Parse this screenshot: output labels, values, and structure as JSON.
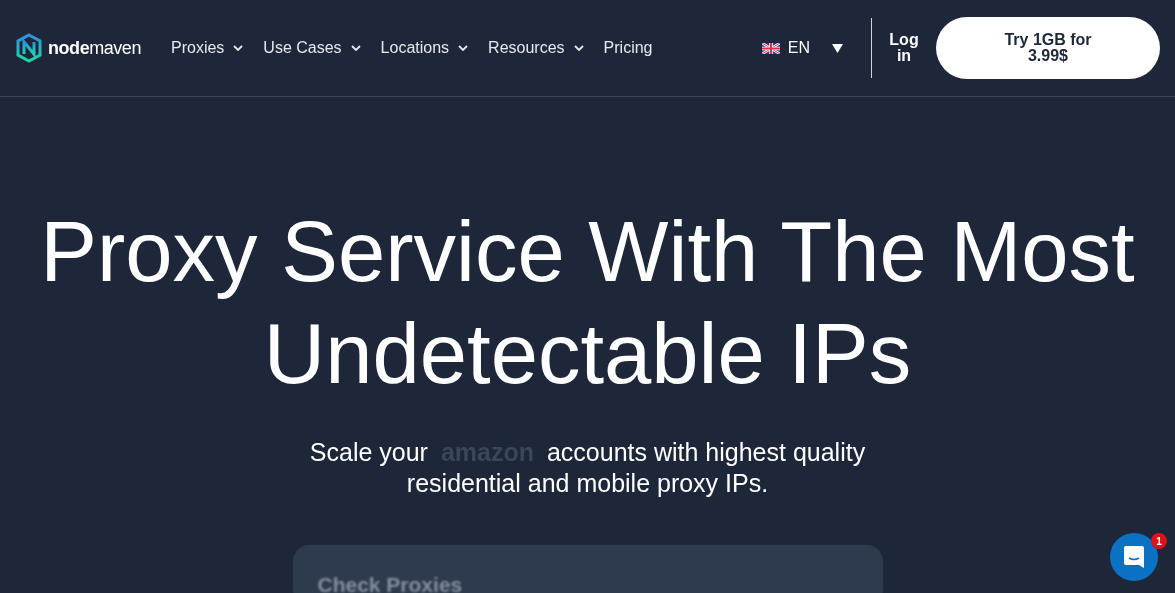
{
  "header": {
    "logo": {
      "text_bold": "node",
      "text_light": "maven"
    },
    "nav": [
      {
        "label": "Proxies",
        "dropdown": true
      },
      {
        "label": "Use Cases",
        "dropdown": true
      },
      {
        "label": "Locations",
        "dropdown": true
      },
      {
        "label": "Resources",
        "dropdown": true
      },
      {
        "label": "Pricing",
        "dropdown": false
      }
    ],
    "language": {
      "code": "EN"
    },
    "login": "Log in",
    "cta": "Try 1GB for 3.99$"
  },
  "hero": {
    "title": "Proxy Service With The Most Undetectable IPs",
    "subtitle_before": "Scale your",
    "subtitle_brand": "amazon",
    "subtitle_after": "accounts with highest quality residential and mobile proxy IPs."
  },
  "card": {
    "title": "Check Proxies"
  },
  "chat": {
    "badge": "1"
  }
}
